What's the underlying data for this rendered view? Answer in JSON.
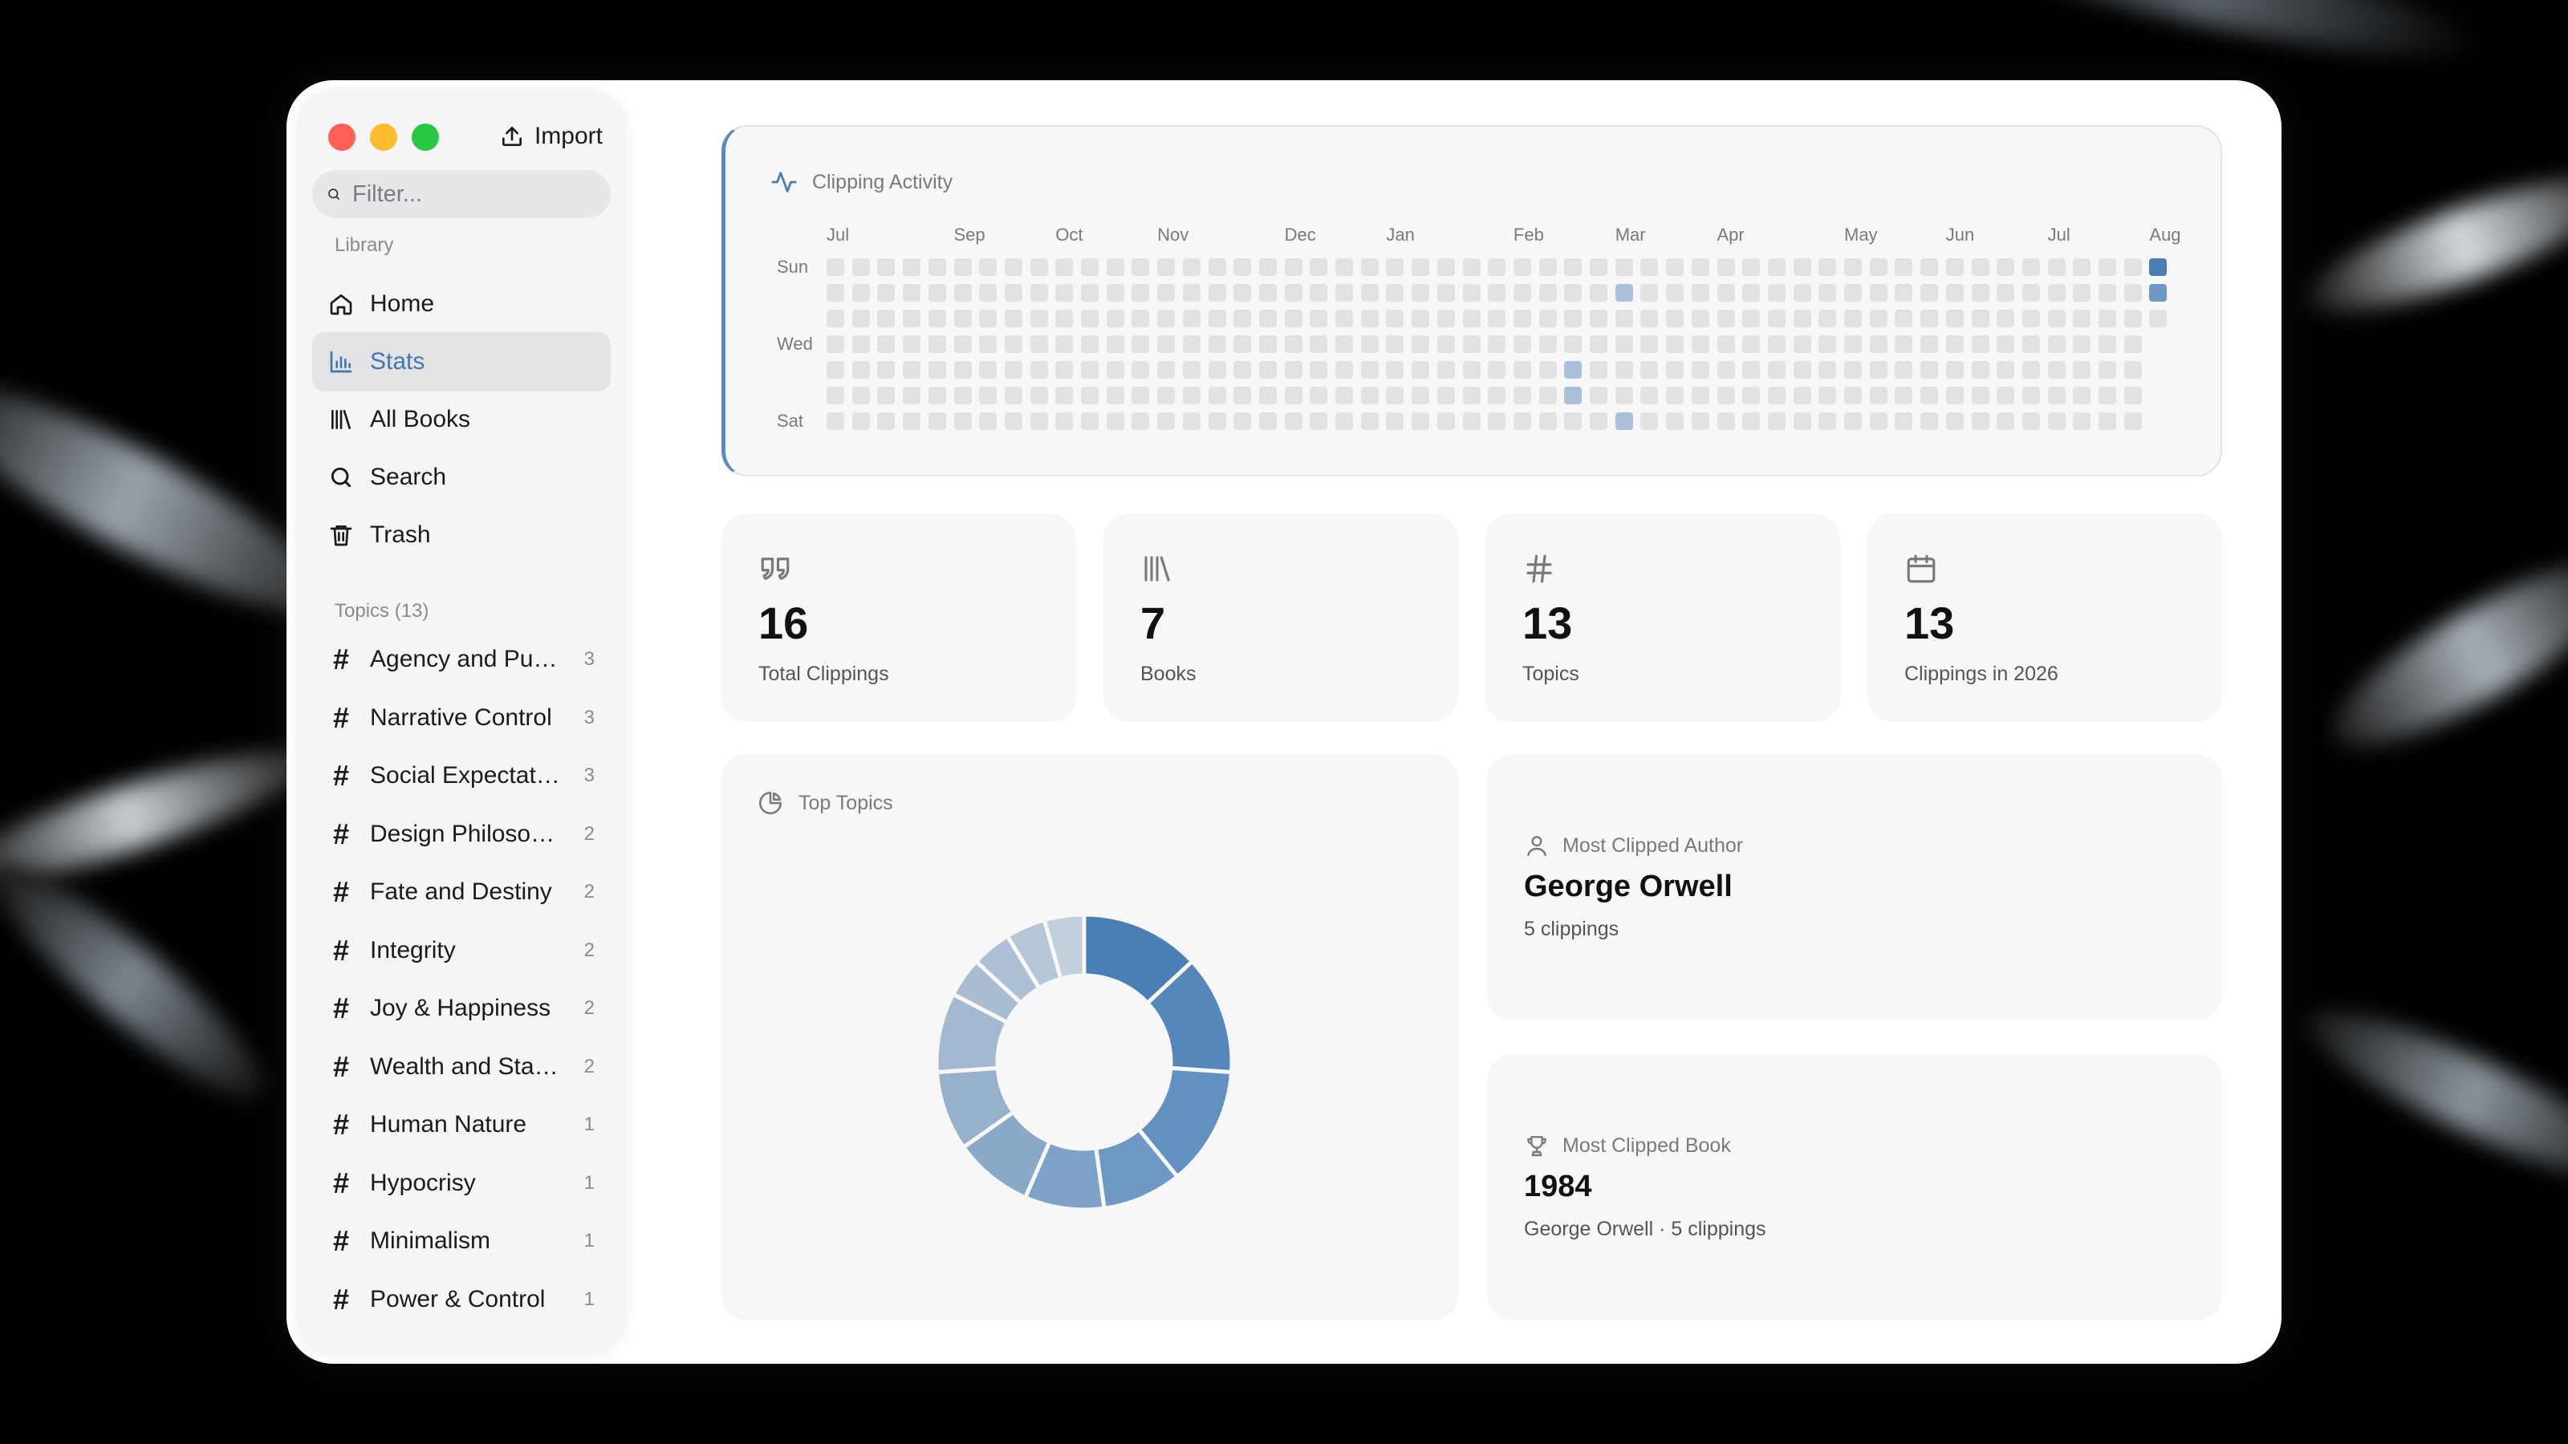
{
  "sidebar": {
    "import_label": "Import",
    "filter_placeholder": "Filter...",
    "library_label": "Library",
    "nav": [
      {
        "label": "Home",
        "icon": "home-icon"
      },
      {
        "label": "Stats",
        "icon": "bar-chart-icon",
        "active": true
      },
      {
        "label": "All Books",
        "icon": "books-icon"
      },
      {
        "label": "Search",
        "icon": "search-icon"
      },
      {
        "label": "Trash",
        "icon": "trash-icon"
      }
    ],
    "topics_label": "Topics (13)",
    "topics": [
      {
        "name": "Agency and Purpo...",
        "count": "3"
      },
      {
        "name": "Narrative Control",
        "count": "3"
      },
      {
        "name": "Social Expectations",
        "count": "3"
      },
      {
        "name": "Design Philosophy",
        "count": "2"
      },
      {
        "name": "Fate and Destiny",
        "count": "2"
      },
      {
        "name": "Integrity",
        "count": "2"
      },
      {
        "name": "Joy & Happiness",
        "count": "2"
      },
      {
        "name": "Wealth and Status",
        "count": "2"
      },
      {
        "name": "Human Nature",
        "count": "1"
      },
      {
        "name": "Hypocrisy",
        "count": "1"
      },
      {
        "name": "Minimalism",
        "count": "1"
      },
      {
        "name": "Power & Control",
        "count": "1"
      }
    ]
  },
  "activity": {
    "title": "Clipping Activity",
    "months": [
      "Jul",
      "Sep",
      "Oct",
      "Nov",
      "Dec",
      "Jan",
      "Feb",
      "Mar",
      "Apr",
      "May",
      "Jun",
      "Jul",
      "Aug"
    ],
    "days": [
      "Sun",
      "Wed",
      "Sat"
    ],
    "weeks": 53,
    "active_cells": [
      {
        "week": 29,
        "day": 4,
        "level": 1
      },
      {
        "week": 29,
        "day": 5,
        "level": 1
      },
      {
        "week": 29,
        "day": 5,
        "level": 1
      },
      {
        "week": 31,
        "day": 1,
        "level": 1
      },
      {
        "week": 31,
        "day": 6,
        "level": 1
      },
      {
        "week": 52,
        "day": 0,
        "level": 3
      },
      {
        "week": 52,
        "day": 1,
        "level": 2
      }
    ],
    "colors": {
      "empty": "#e2e2e4",
      "level1": "#a9c0da",
      "level2": "#7198c4",
      "level3": "#4a7fb6"
    }
  },
  "stats": [
    {
      "icon": "quote-icon",
      "value": "16",
      "label": "Total Clippings"
    },
    {
      "icon": "books-icon",
      "value": "7",
      "label": "Books"
    },
    {
      "icon": "hash-icon",
      "value": "13",
      "label": "Topics"
    },
    {
      "icon": "calendar-icon",
      "value": "13",
      "label": "Clippings in 2026"
    }
  ],
  "top_topics": {
    "title": "Top Topics"
  },
  "chart_data": {
    "type": "pie",
    "donut": true,
    "values": [
      3,
      3,
      3,
      2,
      2,
      2,
      2,
      2,
      1,
      1,
      1,
      1
    ],
    "colors": [
      "#4a7fb6",
      "#5587bb",
      "#6290c1",
      "#6f99c4",
      "#7ea2c7",
      "#8aa9c8",
      "#97b1cb",
      "#a3b9d0",
      "#a8bcd2",
      "#adc0d3",
      "#b6c6d6",
      "#c3cfdb"
    ]
  },
  "most_author": {
    "header": "Most Clipped Author",
    "name": "George Orwell",
    "sub": "5 clippings"
  },
  "most_book": {
    "header": "Most Clipped Book",
    "name": "1984",
    "sub": "George Orwell · 5 clippings"
  }
}
